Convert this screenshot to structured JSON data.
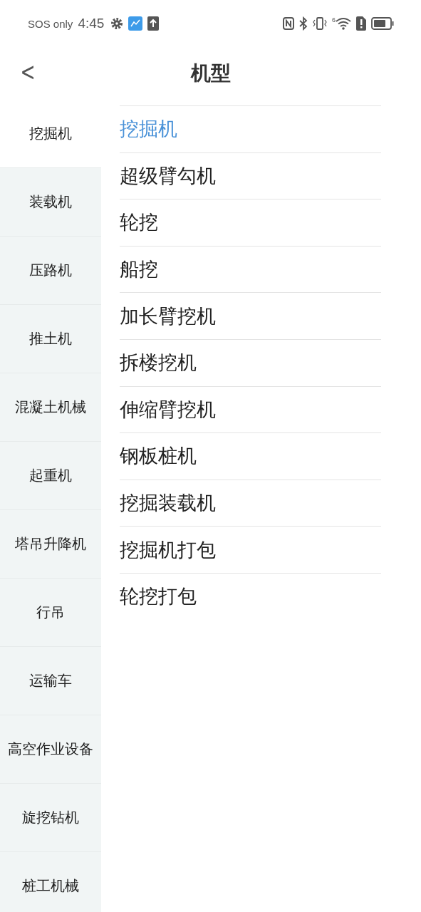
{
  "status_bar": {
    "carrier": "SOS only",
    "time": "4:45",
    "wifi_badge": "6"
  },
  "header": {
    "back": "<",
    "title": "机型"
  },
  "sidebar": {
    "items": [
      {
        "label": "挖掘机",
        "selected": true
      },
      {
        "label": "装载机",
        "selected": false
      },
      {
        "label": "压路机",
        "selected": false
      },
      {
        "label": "推土机",
        "selected": false
      },
      {
        "label": "混凝土机械",
        "selected": false
      },
      {
        "label": "起重机",
        "selected": false
      },
      {
        "label": "塔吊升降机",
        "selected": false
      },
      {
        "label": "行吊",
        "selected": false
      },
      {
        "label": "运输车",
        "selected": false
      },
      {
        "label": "高空作业设备",
        "selected": false
      },
      {
        "label": "旋挖钻机",
        "selected": false
      },
      {
        "label": "桩工机械",
        "selected": false
      }
    ]
  },
  "models": [
    {
      "label": "挖掘机",
      "selected": true
    },
    {
      "label": "超级臂勾机",
      "selected": false
    },
    {
      "label": "轮挖",
      "selected": false
    },
    {
      "label": "船挖",
      "selected": false
    },
    {
      "label": "加长臂挖机",
      "selected": false
    },
    {
      "label": "拆楼挖机",
      "selected": false
    },
    {
      "label": "伸缩臂挖机",
      "selected": false
    },
    {
      "label": "钢板桩机",
      "selected": false
    },
    {
      "label": "挖掘装载机",
      "selected": false
    },
    {
      "label": "挖掘机打包",
      "selected": false
    },
    {
      "label": "轮挖打包",
      "selected": false
    }
  ]
}
